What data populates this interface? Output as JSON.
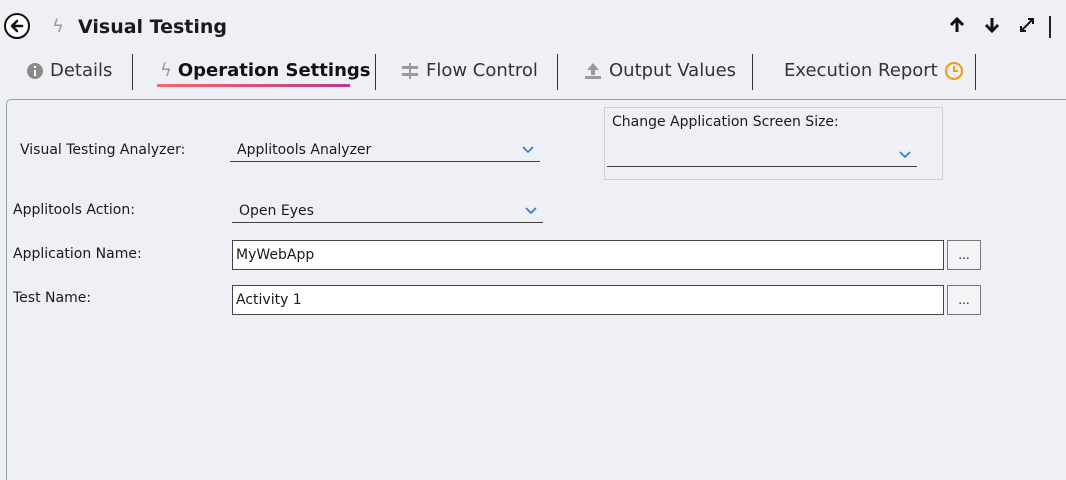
{
  "header": {
    "title": "Visual Testing",
    "icons": {
      "back": "arrow-left-circle-icon",
      "bolt": "lightning-bolt-icon",
      "up": "arrow-up-icon",
      "down": "arrow-down-icon",
      "expand": "expand-icon"
    }
  },
  "tabs": [
    {
      "label": "Details",
      "icon": "info-icon"
    },
    {
      "label": "Operation Settings",
      "icon": "lightning-bolt-icon",
      "active": true
    },
    {
      "label": "Flow Control",
      "icon": "flow-control-icon"
    },
    {
      "label": "Output Values",
      "icon": "upload-icon"
    },
    {
      "label": "Execution Report",
      "icon": "clock-icon"
    }
  ],
  "form": {
    "analyzer": {
      "label": "Visual Testing Analyzer:",
      "value": "Applitools  Analyzer"
    },
    "screen_size": {
      "label": "Change Application Screen Size:",
      "value": ""
    },
    "action": {
      "label": "Applitools Action:",
      "value": "Open Eyes"
    },
    "app_name": {
      "label": "Application Name:",
      "value": "MyWebApp",
      "button": "..."
    },
    "test_name": {
      "label": "Test Name:",
      "value": "Activity 1",
      "button": "..."
    }
  },
  "colors": {
    "accent_gradient_start": "#f06b6b",
    "accent_gradient_end": "#c2368c",
    "chevron": "#2b7bd0",
    "clock": "#f0a020"
  }
}
